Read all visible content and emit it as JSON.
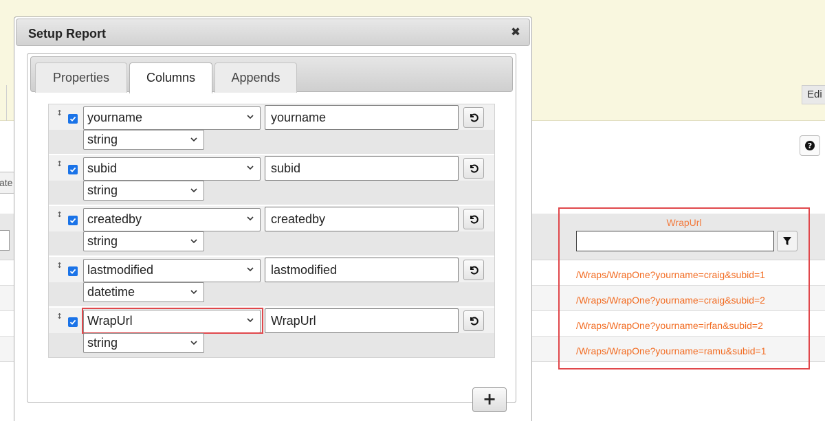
{
  "background": {
    "edit_tab_label": "Edi",
    "create_button_label": "ate",
    "help_icon": "question-circle-icon",
    "wrapurl_column": {
      "header": "WrapUrl",
      "filter_value": "",
      "filter_icon": "filter-icon",
      "cells": [
        "/Wraps/WrapOne?yourname=craig&subid=1",
        "/Wraps/WrapOne?yourname=craig&subid=2",
        "/Wraps/WrapOne?yourname=irfan&subid=2",
        "/Wraps/WrapOne?yourname=ramu&subid=1"
      ]
    }
  },
  "dialog": {
    "title": "Setup Report",
    "close_icon": "close-icon",
    "tabs": [
      {
        "label": "Properties",
        "active": false
      },
      {
        "label": "Columns",
        "active": true
      },
      {
        "label": "Appends",
        "active": false
      }
    ],
    "columns": [
      {
        "checked": true,
        "field": "yourname",
        "display_name": "yourname",
        "type": "string"
      },
      {
        "checked": true,
        "field": "subid",
        "display_name": "subid",
        "type": "string"
      },
      {
        "checked": true,
        "field": "createdby",
        "display_name": "createdby",
        "type": "string"
      },
      {
        "checked": true,
        "field": "lastmodified",
        "display_name": "lastmodified",
        "type": "datetime"
      },
      {
        "checked": true,
        "field": "WrapUrl",
        "display_name": "WrapUrl",
        "type": "string",
        "highlighted": true
      }
    ],
    "add_button_label": "+",
    "colors": {
      "highlight": "#e0474b",
      "link_orange": "#f26b21",
      "checkbox_blue": "#1a73e8",
      "banner": "#f9f7df"
    }
  }
}
